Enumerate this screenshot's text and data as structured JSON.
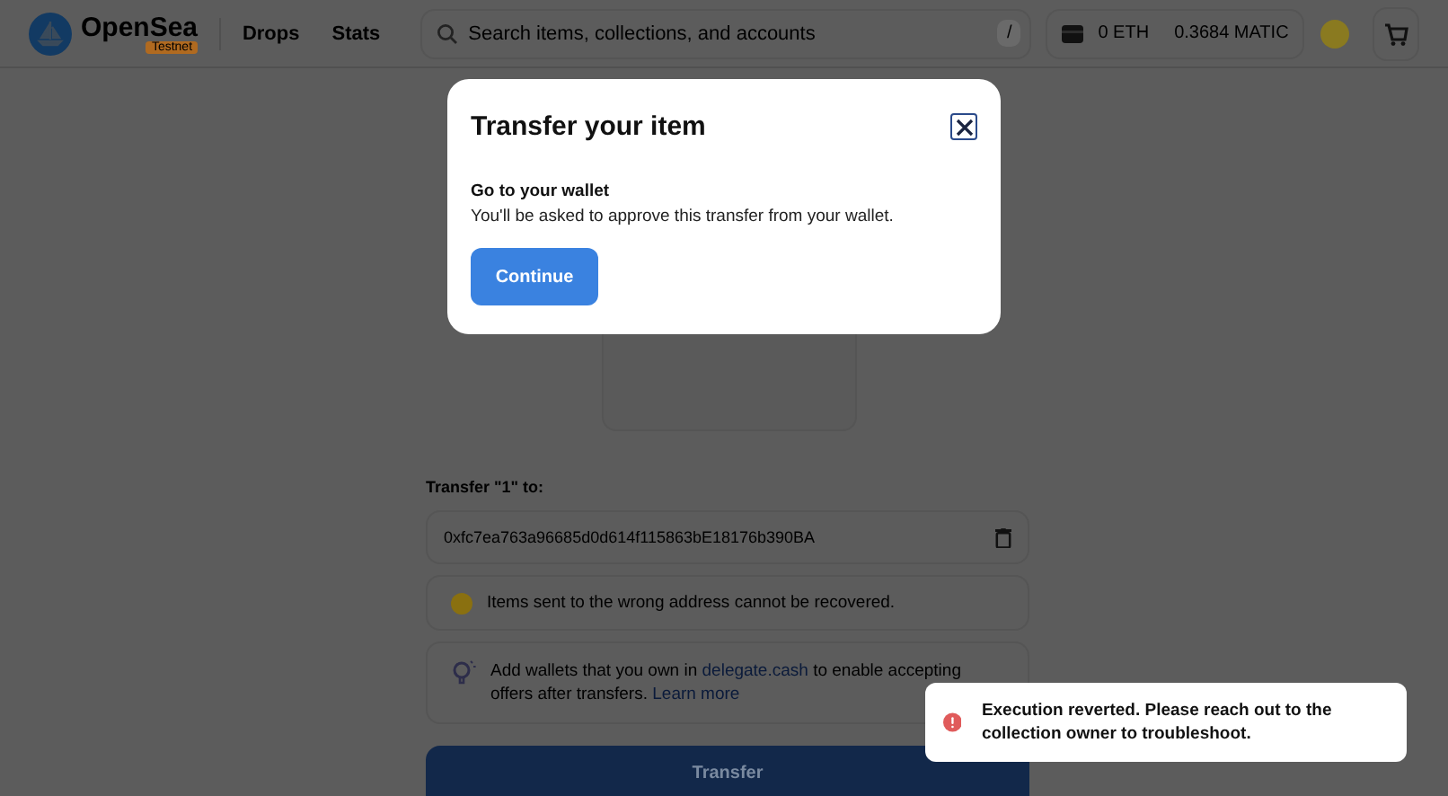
{
  "header": {
    "logo": "OpenSea",
    "badge": "Testnet",
    "nav": [
      {
        "label": "Drops"
      },
      {
        "label": "Stats"
      }
    ],
    "search": {
      "placeholder": "Search items, collections, and accounts",
      "shortcut": "/"
    },
    "balances": [
      {
        "label": "0 ETH"
      },
      {
        "label": "0.3684 MATIC"
      }
    ]
  },
  "transfer": {
    "label": "Transfer \"1\" to:",
    "address": "0xfc7ea763a96685d0d614f115863bE18176b390BA",
    "warning": "Items sent to the wrong address cannot be recovered.",
    "info": {
      "before": "Add wallets that you own in",
      "link": "delegate.cash",
      "middle": "to enable accepting offers after transfers.",
      "link2": "Learn more"
    },
    "button": "Transfer"
  },
  "modal": {
    "title": "Transfer your item",
    "heading": "Go to your wallet",
    "text": "You'll be asked to approve this transfer from your wallet.",
    "button": "Continue"
  },
  "toast": {
    "message": "Execution reverted. Please reach out to the collection owner to troubleshoot."
  }
}
